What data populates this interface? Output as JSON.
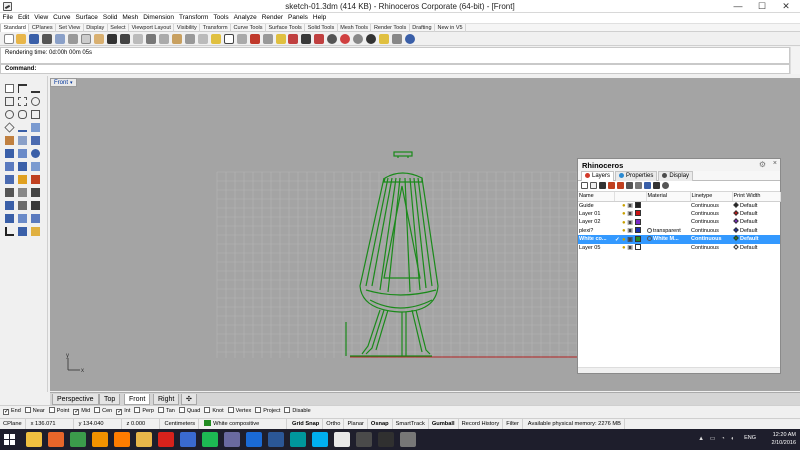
{
  "window": {
    "title": "sketch-01.3dm (414 KB) - Rhinoceros Corporate (64-bit) - [Front]",
    "minimize": "—",
    "maximize": "☐",
    "close": "✕"
  },
  "menu": [
    "File",
    "Edit",
    "View",
    "Curve",
    "Surface",
    "Solid",
    "Mesh",
    "Dimension",
    "Transform",
    "Tools",
    "Analyze",
    "Render",
    "Panels",
    "Help"
  ],
  "toolbar_tabs": [
    "Standard",
    "CPlanes",
    "Set View",
    "Display",
    "Select",
    "Viewport Layout",
    "Visibility",
    "Transform",
    "Curve Tools",
    "Surface Tools",
    "Solid Tools",
    "Mesh Tools",
    "Render Tools",
    "Drafting",
    "New in V5"
  ],
  "command": {
    "history": "Rendering time: 0d:00h 00m 05s",
    "label": "Command:",
    "value": ""
  },
  "viewport": {
    "label": "Front",
    "dropdown": "▾",
    "grid_color": "#b6b6b6",
    "bg_color": "#a4a4a4",
    "model_color": "#1a8a1a",
    "axis_x_color": "#b22222",
    "axis_y_color": "#2e8b2e",
    "axis_labels": {
      "x": "x",
      "y": "y"
    }
  },
  "panel": {
    "title": "Rhinoceros",
    "gear": "⚙",
    "close": "×",
    "tabs": [
      {
        "label": "Layers",
        "color": "#d23a2a"
      },
      {
        "label": "Properties",
        "color": "#2a8ad2"
      },
      {
        "label": "Display",
        "color": "#4a4a4a"
      }
    ],
    "columns": [
      "Name",
      "",
      "Material",
      "Linetype",
      "Print Width"
    ],
    "layers": [
      {
        "name": "Guide",
        "color": "#222222",
        "material": "",
        "linetype": "Continuous",
        "printwidth": "Default",
        "pw_color": "#222222",
        "selected": false,
        "check": ""
      },
      {
        "name": "Layer 01",
        "color": "#cc1111",
        "material": "",
        "linetype": "Continuous",
        "printwidth": "Default",
        "pw_color": "#cc1111",
        "selected": false,
        "check": ""
      },
      {
        "name": "Layer 02",
        "color": "#7a2ac8",
        "material": "",
        "linetype": "Continuous",
        "printwidth": "Default",
        "pw_color": "#7a2ac8",
        "selected": false,
        "check": ""
      },
      {
        "name": "plexi?",
        "color": "#1a2fa8",
        "material": "transparent",
        "linetype": "Continuous",
        "printwidth": "Default",
        "pw_color": "#1a2fa8",
        "selected": false,
        "check": ""
      },
      {
        "name": "White co...",
        "color": "#228b22",
        "material": "White M...",
        "linetype": "Continuous",
        "printwidth": "Default",
        "pw_color": "#228b22",
        "selected": true,
        "check": "✓"
      },
      {
        "name": "Layer 05",
        "color": "#ffffff",
        "material": "",
        "linetype": "Continuous",
        "printwidth": "Default",
        "pw_color": "#ffffff",
        "selected": false,
        "check": ""
      }
    ]
  },
  "view_tabs": [
    "Perspective",
    "Top",
    "Front",
    "Right",
    "✣"
  ],
  "active_view": "Front",
  "osnaps": [
    {
      "label": "End",
      "checked": true
    },
    {
      "label": "Near",
      "checked": false
    },
    {
      "label": "Point",
      "checked": false
    },
    {
      "label": "Mid",
      "checked": true
    },
    {
      "label": "Cen",
      "checked": false
    },
    {
      "label": "Int",
      "checked": true
    },
    {
      "label": "Perp",
      "checked": false
    },
    {
      "label": "Tan",
      "checked": false
    },
    {
      "label": "Quad",
      "checked": false
    },
    {
      "label": "Knot",
      "checked": false
    },
    {
      "label": "Vertex",
      "checked": false
    },
    {
      "label": "Project",
      "checked": false
    },
    {
      "label": "Disable",
      "checked": false
    }
  ],
  "status": {
    "cplane": "CPlane",
    "x": "x 136.071",
    "y": "y 134.040",
    "z": "z 0.000",
    "units": "Centimeters",
    "layer": "White compositive",
    "layer_color": "#228b22",
    "toggles": [
      {
        "label": "Grid Snap",
        "bold": true
      },
      {
        "label": "Ortho",
        "bold": false
      },
      {
        "label": "Planar",
        "bold": false
      },
      {
        "label": "Osnap",
        "bold": true
      },
      {
        "label": "SmartTrack",
        "bold": false
      },
      {
        "label": "Gumball",
        "bold": true
      },
      {
        "label": "Record History",
        "bold": false
      },
      {
        "label": "Filter",
        "bold": false
      }
    ],
    "memory": "Available physical memory: 2276 MB"
  },
  "taskbar": {
    "apps": [
      {
        "name": "file-explorer-icon",
        "color": "#f0c040"
      },
      {
        "name": "firefox-icon",
        "color": "#e8662a"
      },
      {
        "name": "chrome-icon",
        "color": "#3b9b4b"
      },
      {
        "name": "vlc-icon",
        "color": "#f39200"
      },
      {
        "name": "illustrator-icon",
        "color": "#ff7c00"
      },
      {
        "name": "explorer-folder-icon",
        "color": "#e8b64a"
      },
      {
        "name": "acrobat-icon",
        "color": "#d8221c"
      },
      {
        "name": "store-icon",
        "color": "#3a6ad0"
      },
      {
        "name": "spotify-icon",
        "color": "#1db954"
      },
      {
        "name": "photos-icon",
        "color": "#6a6aa0"
      },
      {
        "name": "photoshop-icon",
        "color": "#1a6ad6"
      },
      {
        "name": "word-icon",
        "color": "#2b5797"
      },
      {
        "name": "arduino-icon",
        "color": "#00979c"
      },
      {
        "name": "skype-icon",
        "color": "#00aff0"
      },
      {
        "name": "notepad-icon",
        "color": "#e8e8e8"
      },
      {
        "name": "grasshopper-icon",
        "color": "#4a4a4a"
      },
      {
        "name": "inkscape-icon",
        "color": "#303030"
      },
      {
        "name": "rhino-icon",
        "color": "#777777"
      }
    ],
    "tray_icons": "▲ ▭ ◔ ◖",
    "lang": "ENG",
    "time": "12:20 AM",
    "date": "2/10/2016"
  }
}
